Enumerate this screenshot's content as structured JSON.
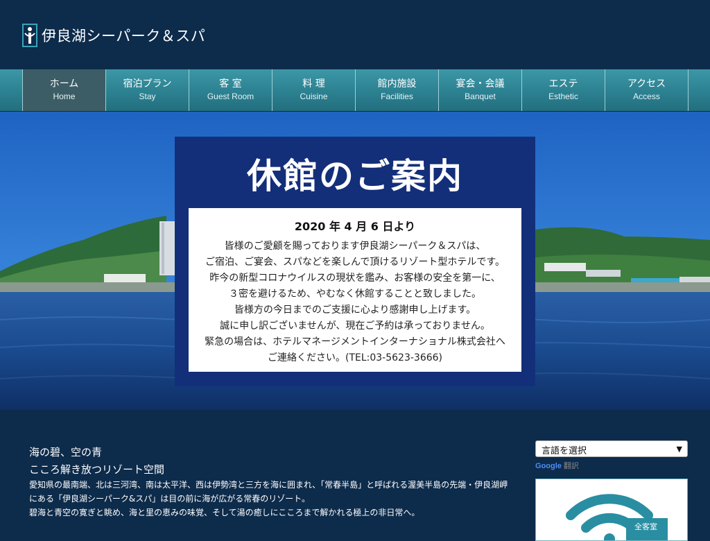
{
  "header": {
    "logo_text": "伊良湖シーパーク＆スパ",
    "logo_icon": "hotel-logo-icon"
  },
  "nav": {
    "items": [
      {
        "jp": "ホーム",
        "en": "Home",
        "active": true
      },
      {
        "jp": "宿泊プラン",
        "en": "Stay"
      },
      {
        "jp": "客 室",
        "en": "Guest Room"
      },
      {
        "jp": "料 理",
        "en": "Cuisine"
      },
      {
        "jp": "館内施設",
        "en": "Facilities"
      },
      {
        "jp": "宴会・会議",
        "en": "Banquet"
      },
      {
        "jp": "エステ",
        "en": "Esthetic"
      },
      {
        "jp": "アクセス",
        "en": "Access"
      }
    ]
  },
  "notice": {
    "title": "休館のご案内",
    "date": "2020 年 4 月 6 日より",
    "lines": [
      "皆様のご愛顧を賜っております伊良湖シーパーク＆スパは、",
      "ご宿泊、ご宴会、スパなどを楽しんで頂けるリゾート型ホテルです。",
      "昨今の新型コロナウイルスの現状を鑑み、お客様の安全を第一に、",
      "３密を避けるため、やむなく休館することと致しました。",
      "皆様方の今日までのご支援に心より感謝申し上げます。",
      "誠に申し訳ございませんが、現在ご予約は承っておりません。",
      "緊急の場合は、ホテルマネージメントインターナショナル株式会社へ",
      "ご連絡ください。(TEL:03-5623-3666)"
    ]
  },
  "intro": {
    "tagline1": "海の碧、空の青",
    "tagline2": "こころ解き放つリゾート空間",
    "lines": [
      "愛知県の最南端、北は三河湾、南は太平洋、西は伊勢湾と三方を海に囲まれ、「常春半島」と呼ばれる渥美半島の先端・伊良湖岬",
      "にある「伊良湖シーパーク&スパ」は目の前に海が広がる常春のリゾート。",
      "碧海と青空の寛ぎと眺め、海と里の恵みの味覚、そして湯の癒しにこころまで解かれる極上の非日常へ。"
    ]
  },
  "sidebar": {
    "language_select": "言語を選択",
    "google_label": "Google",
    "translate_label": "翻訳",
    "wifi_label": "全客室",
    "wifi_icon": "wifi-icon"
  },
  "colors": {
    "background": "#0d2b4b",
    "nav_teal": "#2c8191",
    "notice_blue": "#132f7a"
  }
}
